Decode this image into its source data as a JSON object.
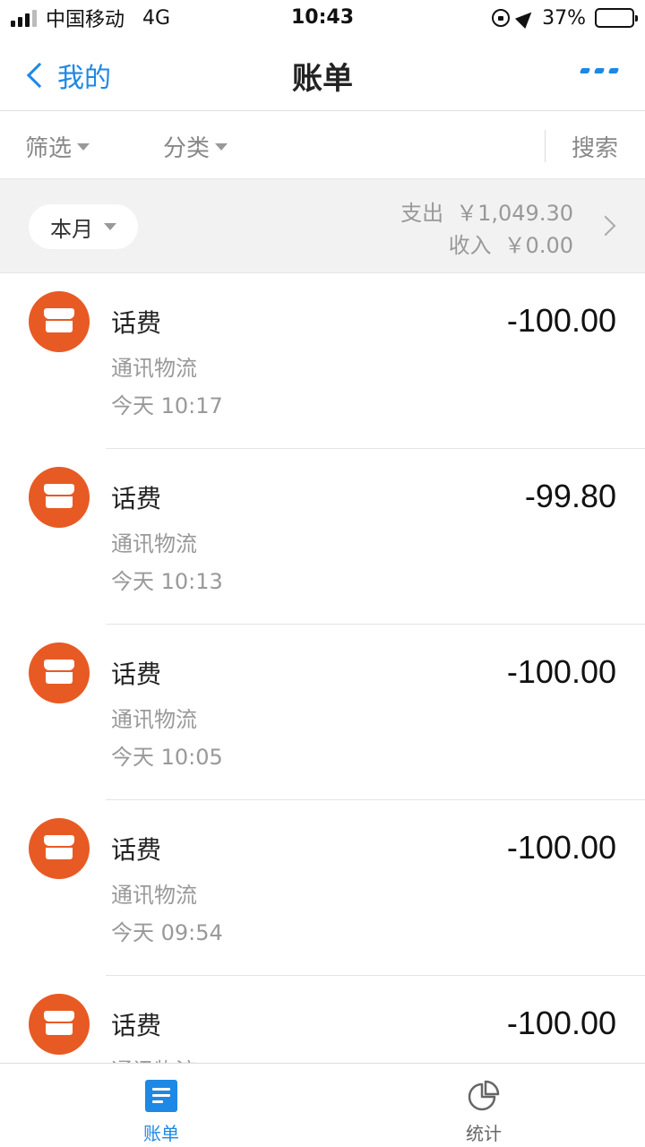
{
  "status_bar": {
    "carrier": "中国移动",
    "network": "4G",
    "time": "10:43",
    "battery_percent": "37%",
    "battery_level": 0.37
  },
  "nav": {
    "back_label": "我的",
    "title": "账单"
  },
  "filters": {
    "filter_label": "筛选",
    "category_label": "分类",
    "search_label": "搜索"
  },
  "month": {
    "selected": "本月",
    "expense_label": "支出",
    "expense_amount": "￥1,049.30",
    "income_label": "收入",
    "income_amount": "￥0.00"
  },
  "transactions": [
    {
      "title": "话费",
      "category": "通讯物流",
      "time": "今天  10:17",
      "amount": "-100.00"
    },
    {
      "title": "话费",
      "category": "通讯物流",
      "time": "今天  10:13",
      "amount": "-99.80"
    },
    {
      "title": "话费",
      "category": "通讯物流",
      "time": "今天  10:05",
      "amount": "-100.00"
    },
    {
      "title": "话费",
      "category": "通讯物流",
      "time": "今天  09:54",
      "amount": "-100.00"
    },
    {
      "title": "话费",
      "category": "通讯物流",
      "time": "",
      "amount": "-100.00"
    }
  ],
  "tab_bar": {
    "bill_label": "账单",
    "stats_label": "统计"
  },
  "colors": {
    "accent": "#1e88e5",
    "icon_orange": "#e85a24"
  },
  "icons": [
    "signal-icon",
    "lock-rotation-icon",
    "location-icon",
    "battery-icon",
    "back-chevron-icon",
    "more-icon",
    "caret-down-icon",
    "chevron-right-icon",
    "store-icon",
    "bill-list-icon",
    "pie-chart-icon"
  ]
}
